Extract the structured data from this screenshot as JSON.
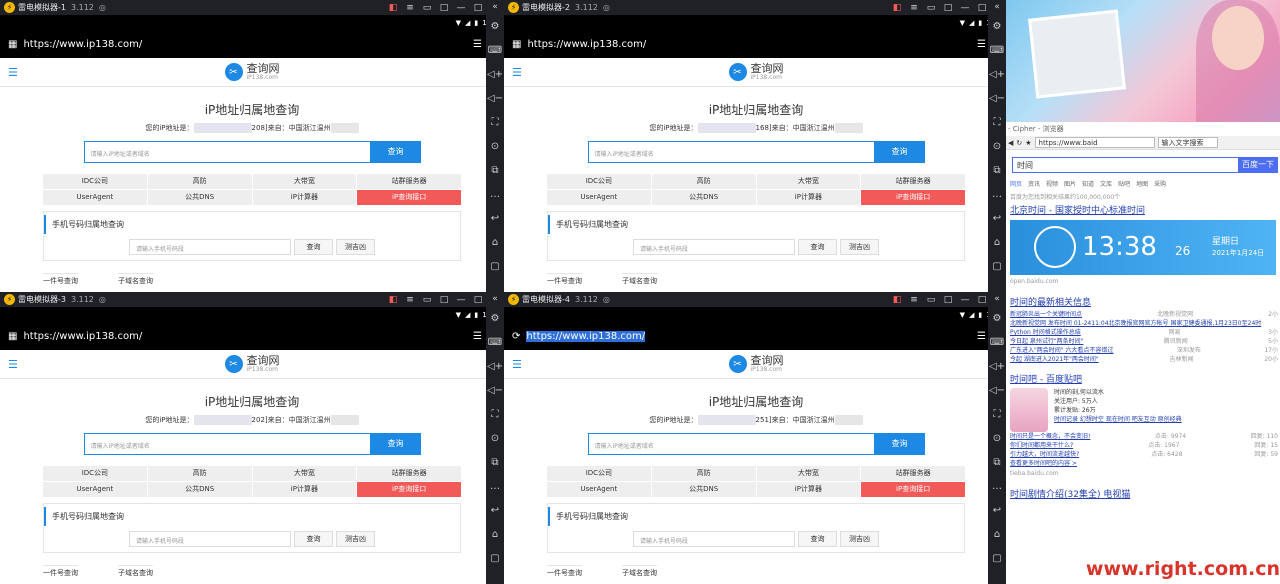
{
  "url": "https://www.ip138.com/",
  "time": "1:38",
  "site": {
    "name": "查询网",
    "domain": "iP138.com",
    "title": "iP地址归属地查询",
    "ip_prefix": "您的iP地址是：",
    "from": "来自：中国浙江温州",
    "search_placeholder": "请输入iP地址或者域名",
    "search_btn": "查询",
    "grid": [
      "IDC公司",
      "高防",
      "大带宽",
      "站群服务器",
      "UserAgent",
      "公共DNS",
      "iP计算器",
      "iP查询接口"
    ],
    "phone_title": "手机号码归属地查询",
    "phone_placeholder": "请输入手机号码段",
    "phone_btn": "查询",
    "luck_btn": "测吉凶",
    "peek1": "一件号查询",
    "peek2": "子域名查询"
  },
  "emulators": [
    {
      "title": "雷电模拟器-1",
      "version": "3.112",
      "ip_suffix": "208]"
    },
    {
      "title": "雷电模拟器-2",
      "version": "3.112",
      "ip_suffix": "168]"
    },
    {
      "title": "雷电模拟器-3",
      "version": "3.112",
      "ip_suffix": "202]"
    },
    {
      "title": "雷电模拟器-4",
      "version": "3.112",
      "ip_suffix": "251]"
    }
  ],
  "browser": {
    "app": "- Cipher - 浏览器",
    "url": "https://www.baid",
    "search_hint": "输入文字搜索",
    "query": "时间",
    "search_btn": "百度一下",
    "tabs": [
      "网页",
      "资讯",
      "视频",
      "图片",
      "知道",
      "文库",
      "贴吧",
      "地图",
      "采购"
    ],
    "result_count": "百度为您找到相关结果约100,000,000个",
    "tool": "搜索工具",
    "r1_title": "北京时间 - 国家授时中心标准时间",
    "clock_time": "13:38",
    "clock_sec": "26",
    "weekday": "星期日",
    "date": "2021年1月24日",
    "r1_src": "open.baidu.com",
    "r2_title": "时间的最新相关信息",
    "news": [
      {
        "t": "新冠肺炎出一个关键时间点",
        "s": "北晚新视觉网",
        "d": "2小"
      },
      {
        "t": "北晚新视觉网 发布时间 01-2411:04北京晚报官网官方帐号 国家卫健委通报,1月23日0至24时",
        "s": "",
        "d": ""
      },
      {
        "t": "Python 时间格式操作总结",
        "s": "网易",
        "d": "3小"
      },
      {
        "t": "今日起 泉州试行\"两条时间\"",
        "s": "腾讯新闻",
        "d": "5小"
      },
      {
        "t": "广东进入\"两会时间\" 六大看点不容错过",
        "s": "深圳发布",
        "d": "17小"
      },
      {
        "t": "今起 湖南进入2021年\"两会时间\"",
        "s": "吉林新闻",
        "d": "20小"
      }
    ],
    "r3_title": "时间吧 - 百度贴吧",
    "tb_lines": [
      "时间的刻,何以流水",
      "关注用户: 5万人",
      "累计发贴: 26万"
    ],
    "tb_links": "时间记录 幻想时空 现在时间 吧友互动 原创经典",
    "tb_posts": [
      {
        "t": "时间只是一个概念，不会变旧!",
        "a": "点击: 9974",
        "b": "回复: 110"
      },
      {
        "t": "你们时间都用来干什么?",
        "a": "点击: 1967",
        "b": "回复: 15"
      },
      {
        "t": "引力越大，时间流逝越快?",
        "a": "点击: 6428",
        "b": "回复: 59"
      }
    ],
    "tb_more": "查看更多时间吧的内容 >",
    "tb_src": "tieba.baidu.com",
    "r4_title": "时间剧情介绍(32集全) 电视猫",
    "r4_sub": "电视猫"
  },
  "watermark": "www.right.com.cn"
}
